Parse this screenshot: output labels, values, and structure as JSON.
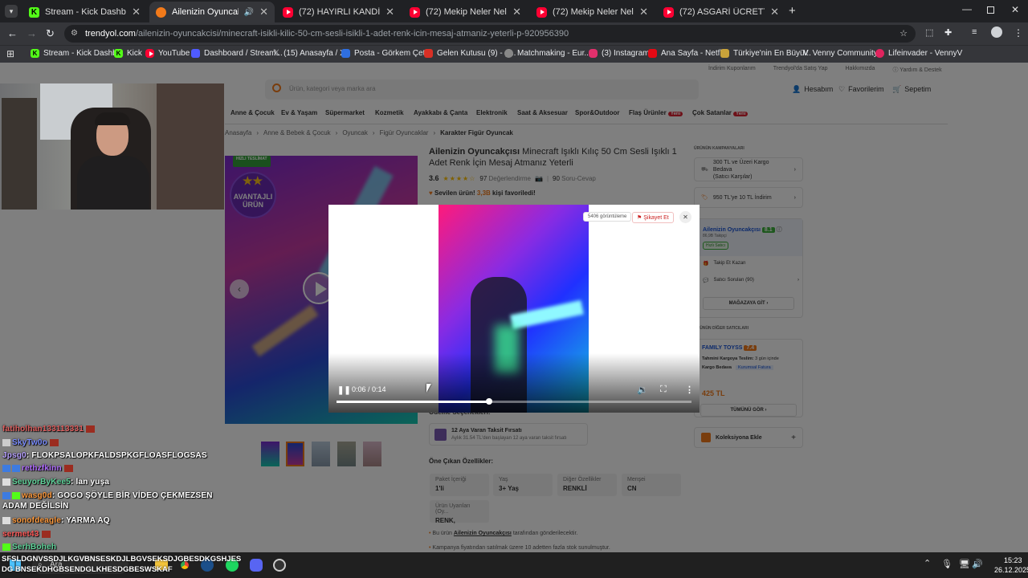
{
  "tabs": [
    {
      "icon": "kick",
      "title": "Stream - Kick Dashboard",
      "active": false
    },
    {
      "icon": "trendyol",
      "title": "Ailenizin Oyuncakçısı Minec",
      "active": true
    },
    {
      "icon": "youtube",
      "title": "(72) HAYIRLI KANDİLLER | Mad",
      "active": false
    },
    {
      "icon": "youtube",
      "title": "(72) Mekip Neler Neler 31.Bölü",
      "active": false
    },
    {
      "icon": "youtube",
      "title": "(72) Mekip Neler Neler 30.bölu",
      "active": false
    },
    {
      "icon": "youtube",
      "title": "(72) ASGARİ ÜCRETTEKİ 50 KU",
      "active": false
    }
  ],
  "url": {
    "host": "trendyol.com",
    "path": "/ailenizin-oyuncakcisi/minecraft-isikli-kilic-50-cm-sesli-isikli-1-adet-renk-icin-mesaj-atmaniz-yeterli-p-920956390"
  },
  "bookmarks": [
    "Stream - Kick Dashb...",
    "Kick",
    "YouTube",
    "Dashboard / Stream...",
    "(15) Anasayfa / X",
    "Posta - Görkem Çeti...",
    "Gelen Kutusu (9) - g...",
    "Matchmaking - Eur...",
    "(3) Instagram",
    "Ana Sayfa - Netflix",
    "Türkiye'nin En Büyü...",
    "Venny Community",
    "Lifeinvader - VennyV"
  ],
  "site": {
    "top_links": [
      "İndirim Kuponlarım",
      "Trendyol'da Satış Yap",
      "Hakkımızda",
      "Yardım & Destek"
    ],
    "search_placeholder": "Ürün, kategori veya marka ara",
    "account": "Hesabım",
    "favorites": "Favorilerim",
    "cart": "Sepetim",
    "categories": [
      "Anne & Çocuk",
      "Ev & Yaşam",
      "Süpermarket",
      "Kozmetik",
      "Ayakkabı & Çanta",
      "Elektronik",
      "Saat & Aksesuar",
      "Spor&Outdoor",
      "Flaş Ürünler",
      "Çok Satanlar"
    ],
    "new_badge": "Yeni",
    "breadcrumb": [
      "Anasayfa",
      "Anne & Bebek & Çocuk",
      "Oyuncak",
      "Figür Oyuncaklar",
      "Karakter Figür Oyuncak"
    ],
    "image_badges": {
      "fast": "HIZLI TESLİMAT",
      "advantage_line1": "AVANTAJLI",
      "advantage_line2": "ÜRÜN"
    },
    "product_brand": "Ailenizin Oyuncakçısı",
    "product_title_line1": "Minecraft Işıklı Kılıç 50 Cm Sesli Işıklı 1",
    "product_title_line2": "Adet Renk İçin Mesaj Atmanız Yeterli",
    "rating": "3.6",
    "reviews_count": "97",
    "reviews_label": "Değerlendirme",
    "qa_count": "90",
    "qa_label": "Soru-Cevap",
    "favorited_prefix": "Sevilen ürün!",
    "favorited_count": "3,3B",
    "favorited_suffix": "kişi favoriledi!",
    "payment_title": "Ödeme Seçenekleri:",
    "installment_title": "12 Aya Varan Taksit Fırsatı",
    "installment_desc": "Aylık 31.54 TL'den başlayan 12 aya varan taksit fırsatı",
    "features_title": "Öne Çıkan Özellikler:",
    "features": [
      {
        "label": "Paket İçeriği",
        "value": "1'li"
      },
      {
        "label": "Yaş",
        "value": "3+ Yaş"
      },
      {
        "label": "Diğer Özellikler",
        "value": "RENKLİ"
      },
      {
        "label": "Menşei",
        "value": "CN"
      },
      {
        "label": "Ürün Uyarıları (Oy...",
        "value": "RENK,"
      }
    ],
    "notes": [
      {
        "prefix": "Bu ürün",
        "seller": "Ailenizin Oyuncakçısı",
        "suffix": "tarafından gönderilecektir."
      },
      {
        "text": "Kampanya fiyatından satılmak üzere 10 adetten fazla stok sunulmuştur."
      }
    ],
    "campaigns_title": "ÜRÜNÜN KAMPANYALARI",
    "campaign1_line1": "300 TL ve Üzeri Kargo Bedava",
    "campaign1_line2": "(Satıcı Karşılar)",
    "campaign2": "950 TL'ye 10 TL İndirim",
    "seller_name": "Ailenizin Oyuncakçısı",
    "seller_score": "8.1",
    "seller_followers": "86,9B Takipçi",
    "seller_badge": "Hızlı Satıcı",
    "follow_earn": "Takip Et Kazan",
    "seller_questions": "Satıcı Soruları (90)",
    "go_store": "MAĞAZAYA GİT",
    "other_sellers_title": "ÜRÜNÜN DİĞER SATICILARI",
    "other_seller_name": "FAMILY TOYSS",
    "other_seller_score": "7.4",
    "other_delivery_label": "Tahmini Kargoya Teslim:",
    "other_delivery_value": "3 gün içinde",
    "cargo_free": "Kargo Bedava",
    "corporate_invoice": "Kurumsal Fatura",
    "other_price": "425 TL",
    "see_all": "TÜMÜNÜ GÖR",
    "collection_add": "Koleksiyona Ekle"
  },
  "video_modal": {
    "views": "5406 görüntüleme",
    "report": "Şikayet Et",
    "time": "0:06 / 0:14",
    "progress": 0.43
  },
  "chat": [
    {
      "user": "fatiholhan133113331",
      "msg": "",
      "color": "#e06060"
    },
    {
      "user": "SkyTw0o",
      "msg": "",
      "color": "#7a8cff"
    },
    {
      "user": "Jpsg0",
      "msg": ": FLOKPSALOPKFALDSPKGFLOASFLOGSAS",
      "color": "#b7a0ff"
    },
    {
      "user": "rethzfkinn",
      "msg": "",
      "color": "#b06cff"
    },
    {
      "user": "SeuyorByKee5",
      "msg": ": lan yuşa",
      "color": "#5fd39a"
    },
    {
      "user": "wasg0d",
      "msg": ": GOGO ŞÖYLE BİR VİDEO ÇEKMEZSEN ADAM DEĞİLSİN",
      "color": "#ff9a3c"
    },
    {
      "user": "sonofdeagle",
      "msg": ": YARMA AQ",
      "color": "#ff9a3c"
    },
    {
      "user": "sermet43",
      "msg": "",
      "color": "#ff5a5a"
    },
    {
      "user": "SerhBoheh",
      "msg": "",
      "color": "#5fd39a"
    }
  ],
  "chat_overlay_text": "SFSLDGNVSSDJLKGVBNSESKDJLBGVSEKSDJGBESDKGSHJESDG BNSEKDHGBSENDGLKHESDGBESWSKAF",
  "taskbar": {
    "search": "Ara",
    "time": "15:23",
    "date": "26.12.2025"
  }
}
